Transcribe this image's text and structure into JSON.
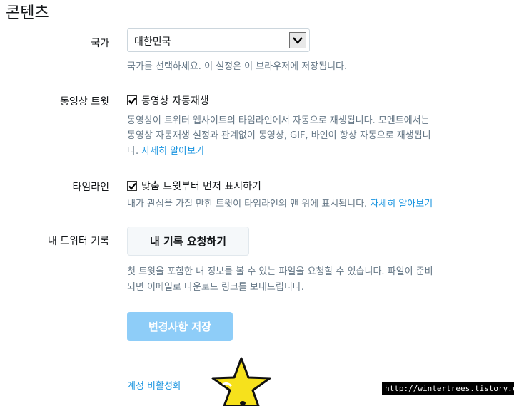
{
  "section": {
    "title": "콘텐츠"
  },
  "country": {
    "label": "국가",
    "selected": "대한민국",
    "help": "국가를 선택하세요. 이 설정은 이 브라우저에 저장됩니다."
  },
  "video_tweets": {
    "label": "동영상 트윗",
    "checkbox_label": "동영상 자동재생",
    "checked": true,
    "help_line1": "동영상이 트위터 웹사이트의 타임라인에서 자동으로 재생됩니다. 모멘트에서는",
    "help_line2": "동영상 자동재생 설정과 관계없이 동영상, GIF, 바인이 항상 자동으로 재생됩니",
    "help_line3_prefix": "다.",
    "learn_more": "자세히 알아보기"
  },
  "timeline": {
    "label": "타임라인",
    "checkbox_label": "맞춤 트윗부터 먼저 표시하기",
    "checked": true,
    "help": "내가 관심을 가질 만한 트윗이 타임라인의 맨 위에 표시됩니다.",
    "learn_more": "자세히 알아보기"
  },
  "archive": {
    "label": "내 트위터 기록",
    "button": "내 기록 요청하기",
    "help_line1": "첫 트윗을 포함한 내 정보를 볼 수 있는 파일을 요청할 수 있습니다. 파일이 준비",
    "help_line2": "되면 이메일로 다운로드 링크를 보내드립니다."
  },
  "save_button": "변경사항 저장",
  "deactivate_link": "계정 비활성화",
  "watermark": "http://wintertrees.tistory.co",
  "colors": {
    "link": "#1b95e0",
    "primary_disabled": "#8ecdf8",
    "help_text": "#657786"
  }
}
